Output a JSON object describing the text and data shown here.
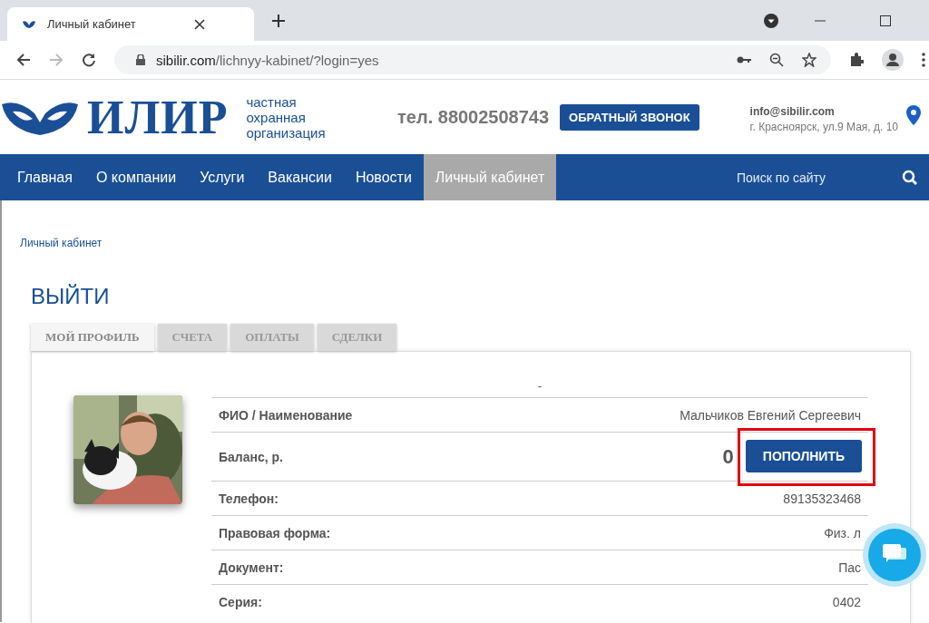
{
  "browser": {
    "tab_title": "Личный кабинет",
    "url_host": "sibilir.com",
    "url_path": "/lichnyy-kabinet/?login=yes"
  },
  "header": {
    "brand": "ИЛИР",
    "tagline": [
      "частная",
      "охранная",
      "организация"
    ],
    "phone": "тел. 88002508743",
    "callback_button": "ОБРАТНЫЙ ЗВОНОК",
    "email": "info@sibilir.com",
    "address": "г. Красноярск, ул.9 Мая, д. 10"
  },
  "nav": {
    "items": [
      {
        "label": "Главная",
        "selected": false
      },
      {
        "label": "О компании",
        "selected": false
      },
      {
        "label": "Услуги",
        "selected": false
      },
      {
        "label": "Вакансии",
        "selected": false
      },
      {
        "label": "Новости",
        "selected": false
      },
      {
        "label": "Личный кабинет",
        "selected": true
      }
    ],
    "search": {
      "placeholder": "Поиск по сайту"
    }
  },
  "breadcrumb": "Личный кабинет",
  "logout": "ВЫЙТИ",
  "tabs": [
    {
      "label": "МОЙ ПРОФИЛЬ",
      "selected": true
    },
    {
      "label": "СЧЕТА",
      "selected": false
    },
    {
      "label": "ОПЛАТЫ",
      "selected": false
    },
    {
      "label": "СДЕЛКИ",
      "selected": false
    }
  ],
  "profile": {
    "caption": "-",
    "rows": [
      {
        "kind": "text",
        "label": "ФИО / Наименование",
        "value": "Мальчиков Евгений Сергеевич"
      },
      {
        "kind": "balance",
        "label": "Баланс, р.",
        "value": "0",
        "button": "ПОПОЛНИТЬ",
        "highlighted": true
      },
      {
        "kind": "text",
        "label": "Телефон:",
        "value": "89135323468"
      },
      {
        "kind": "text",
        "label": "Правовая форма:",
        "value": "Физ. л"
      },
      {
        "kind": "text",
        "label": "Документ:",
        "value": "Пас"
      },
      {
        "kind": "text",
        "label": "Серия:",
        "value": "0402"
      }
    ]
  }
}
